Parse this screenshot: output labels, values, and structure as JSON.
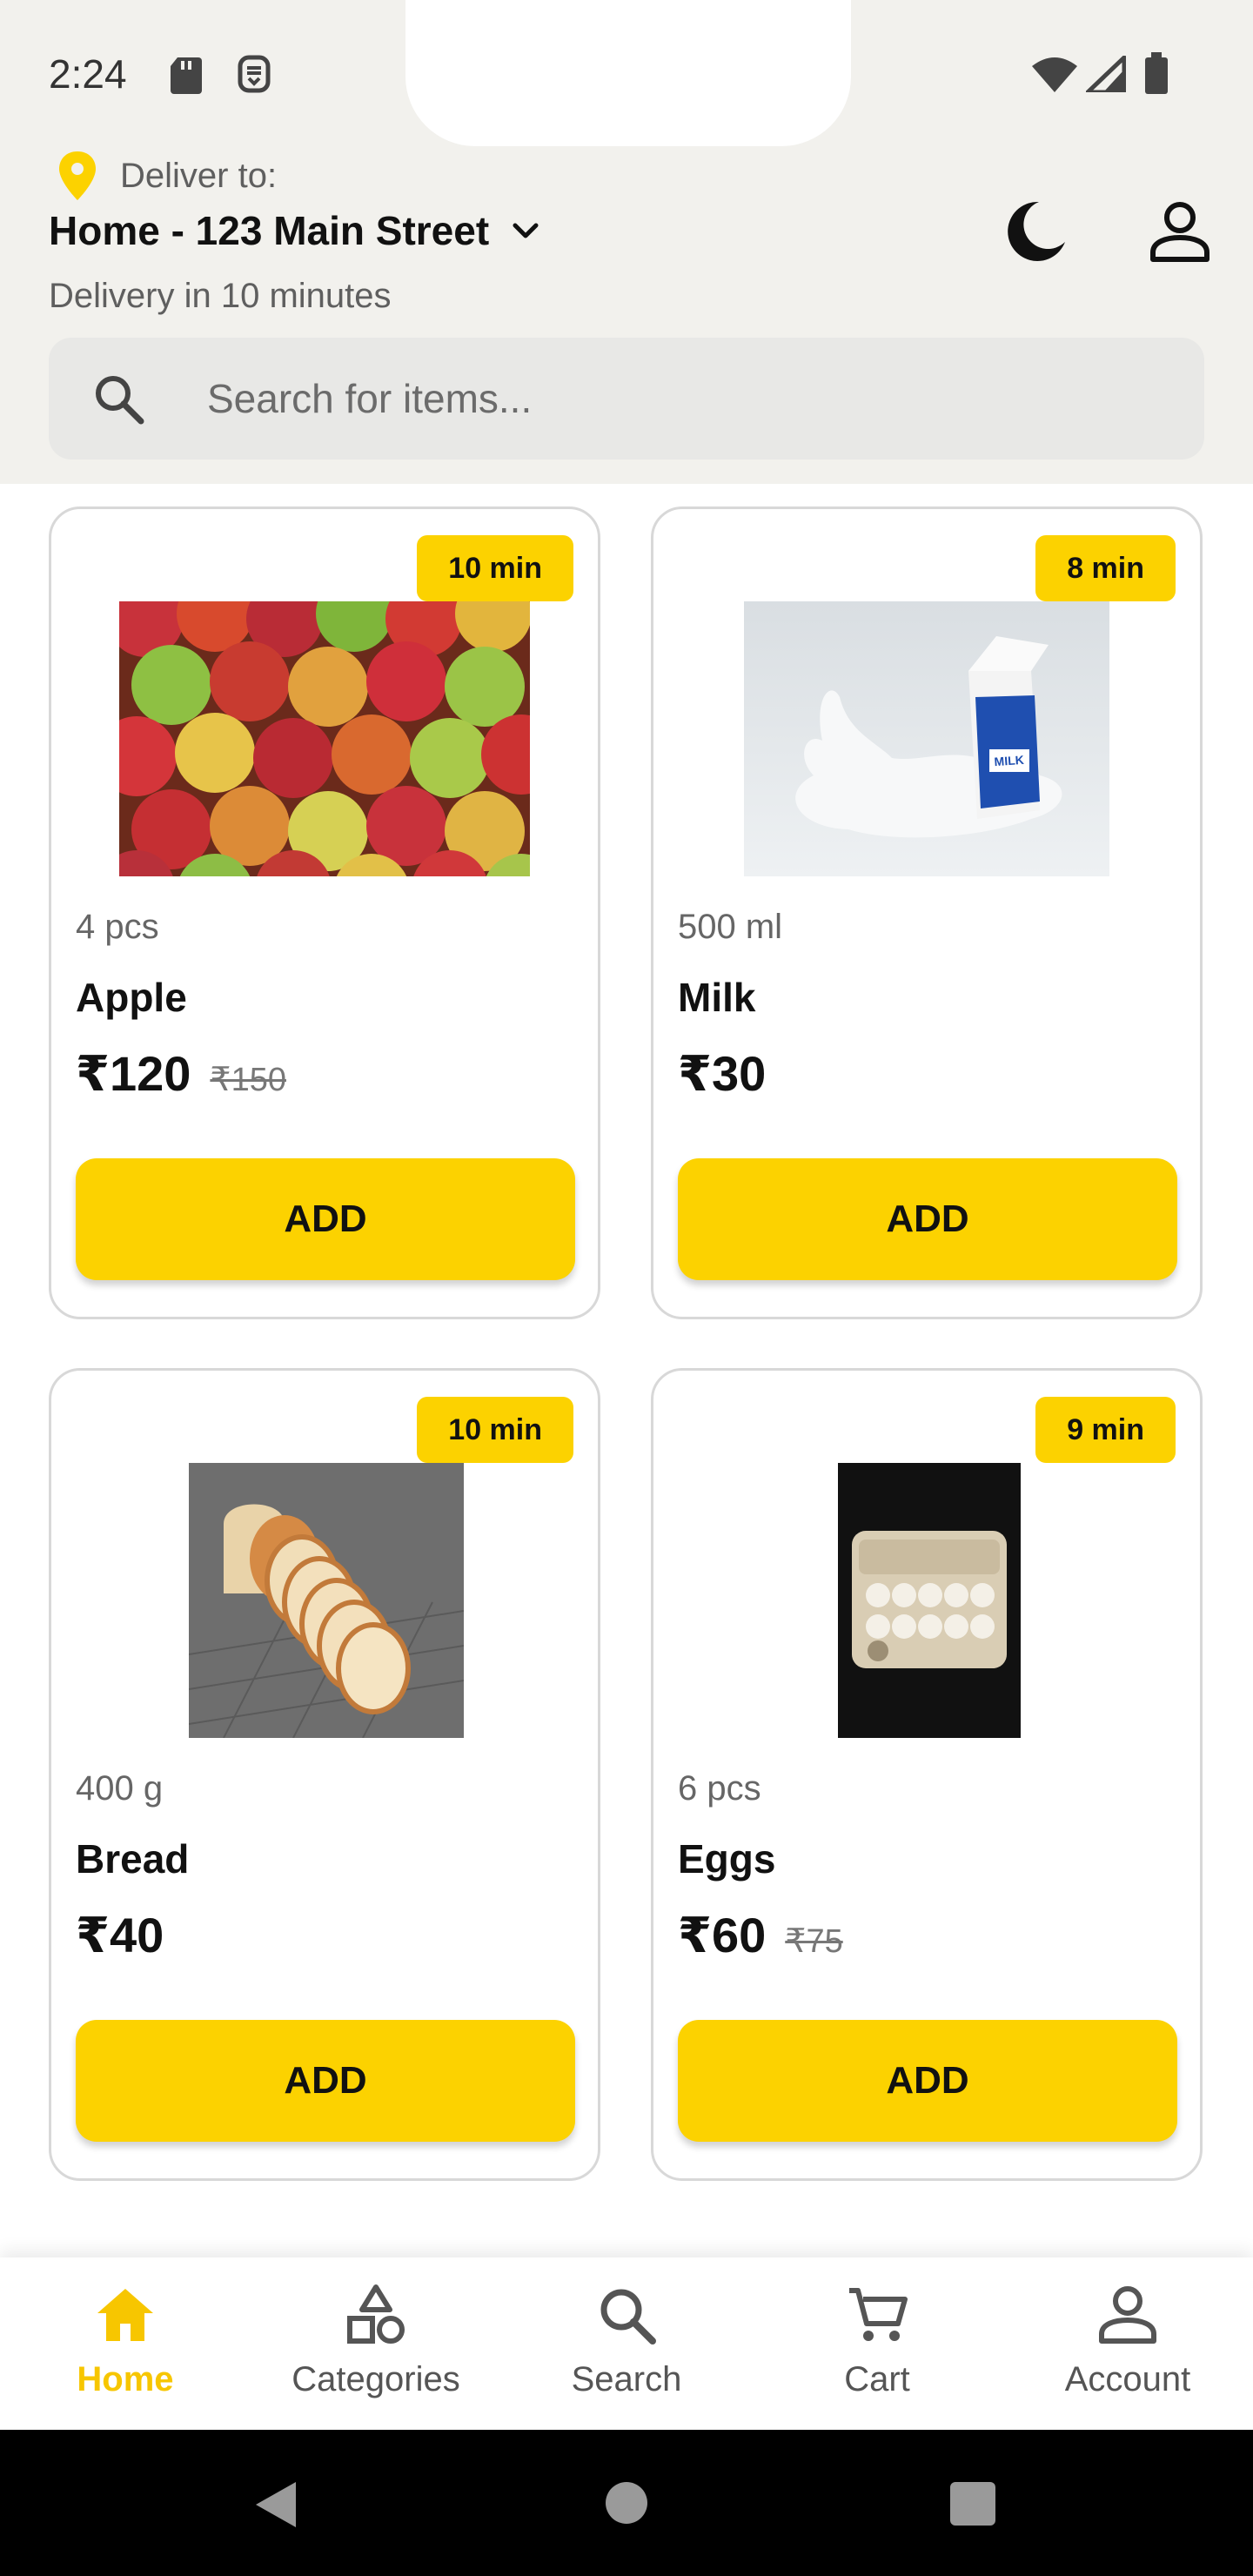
{
  "status_bar": {
    "time": "2:24",
    "icons": [
      "sd-card-icon",
      "notification-icon",
      "wifi-icon",
      "cell-signal-icon",
      "battery-icon"
    ]
  },
  "header": {
    "deliver_label": "Deliver to:",
    "address": "Home - 123 Main Street",
    "eta_text": "Delivery in 10 minutes",
    "icons": [
      "location-pin-icon",
      "chevron-down-icon",
      "dark-mode-moon-icon",
      "profile-icon"
    ]
  },
  "search": {
    "placeholder": "Search for items...",
    "value": ""
  },
  "products": [
    {
      "eta": "10 min",
      "qty": "4 pcs",
      "name": "Apple",
      "price": "₹120",
      "mrp": "₹150",
      "add_label": "ADD",
      "image": "apples"
    },
    {
      "eta": "8 min",
      "qty": "500 ml",
      "name": "Milk",
      "price": "₹30",
      "mrp": "",
      "add_label": "ADD",
      "image": "milk carton"
    },
    {
      "eta": "10 min",
      "qty": "400 g",
      "name": "Bread",
      "price": "₹40",
      "mrp": "",
      "add_label": "ADD",
      "image": "sliced bread loaf"
    },
    {
      "eta": "9 min",
      "qty": "6 pcs",
      "name": "Eggs",
      "price": "₹60",
      "mrp": "₹75",
      "add_label": "ADD",
      "image": "egg carton"
    }
  ],
  "bottom_nav": {
    "items": [
      {
        "label": "Home",
        "icon": "home-icon",
        "active": true
      },
      {
        "label": "Categories",
        "icon": "categories-icon",
        "active": false
      },
      {
        "label": "Search",
        "icon": "search-icon",
        "active": false
      },
      {
        "label": "Cart",
        "icon": "cart-icon",
        "active": false
      },
      {
        "label": "Account",
        "icon": "account-icon",
        "active": false
      }
    ]
  },
  "colors": {
    "accent": "#fcd200",
    "active_nav": "#f7c600",
    "header_bg": "#f2f1ed",
    "card_border": "#d8d8d8"
  }
}
